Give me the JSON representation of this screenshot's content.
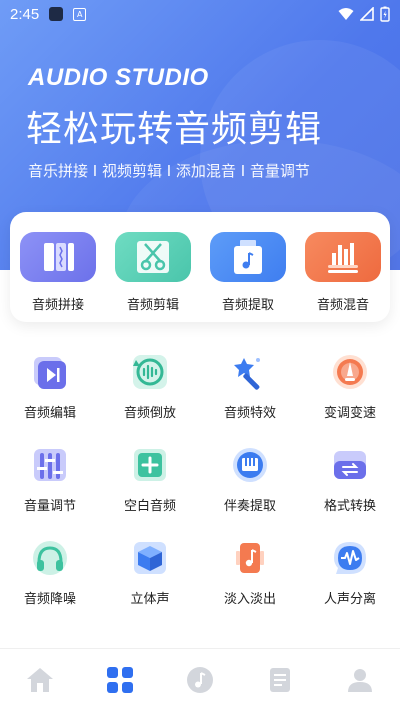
{
  "status_bar": {
    "time": "2:45",
    "notification_icon": "app-icon",
    "a_label": "A"
  },
  "hero": {
    "brand": "AUDIO STUDIO",
    "headline": "轻松玩转音频剪辑",
    "subline": "音乐拼接 I 视频剪辑 I 添加混音 I 音量调节"
  },
  "main_tools": [
    {
      "label": "音频拼接",
      "icon": "merge-icon",
      "color": "#7f84f2"
    },
    {
      "label": "音频剪辑",
      "icon": "scissors-icon",
      "color": "#5fd2b9"
    },
    {
      "label": "音频提取",
      "icon": "extract-icon",
      "color": "#4e8df6"
    },
    {
      "label": "音频混音",
      "icon": "mixer-icon",
      "color": "#f47a50"
    }
  ],
  "tools": [
    {
      "label": "音频编辑",
      "icon": "play-next-icon"
    },
    {
      "label": "音频倒放",
      "icon": "reverse-icon"
    },
    {
      "label": "音频特效",
      "icon": "magic-wand-icon"
    },
    {
      "label": "变调变速",
      "icon": "speed-gauge-icon"
    },
    {
      "label": "音量调节",
      "icon": "volume-sliders-icon"
    },
    {
      "label": "空白音频",
      "icon": "add-blank-icon"
    },
    {
      "label": "伴奏提取",
      "icon": "piano-icon"
    },
    {
      "label": "格式转换",
      "icon": "convert-icon"
    },
    {
      "label": "音频降噪",
      "icon": "headphones-icon"
    },
    {
      "label": "立体声",
      "icon": "cube-icon"
    },
    {
      "label": "淡入淡出",
      "icon": "fade-icon"
    },
    {
      "label": "人声分离",
      "icon": "voice-separate-icon"
    }
  ],
  "bottom_nav": [
    {
      "name": "home",
      "icon": "home-icon",
      "active": false
    },
    {
      "name": "tools",
      "icon": "grid-icon",
      "active": true
    },
    {
      "name": "music",
      "icon": "music-icon",
      "active": false
    },
    {
      "name": "docs",
      "icon": "document-icon",
      "active": false
    },
    {
      "name": "profile",
      "icon": "user-icon",
      "active": false
    }
  ],
  "colors": {
    "hero": "#5b82ee",
    "accent": "#2f6ff0",
    "inactive": "#d3d6dc"
  }
}
